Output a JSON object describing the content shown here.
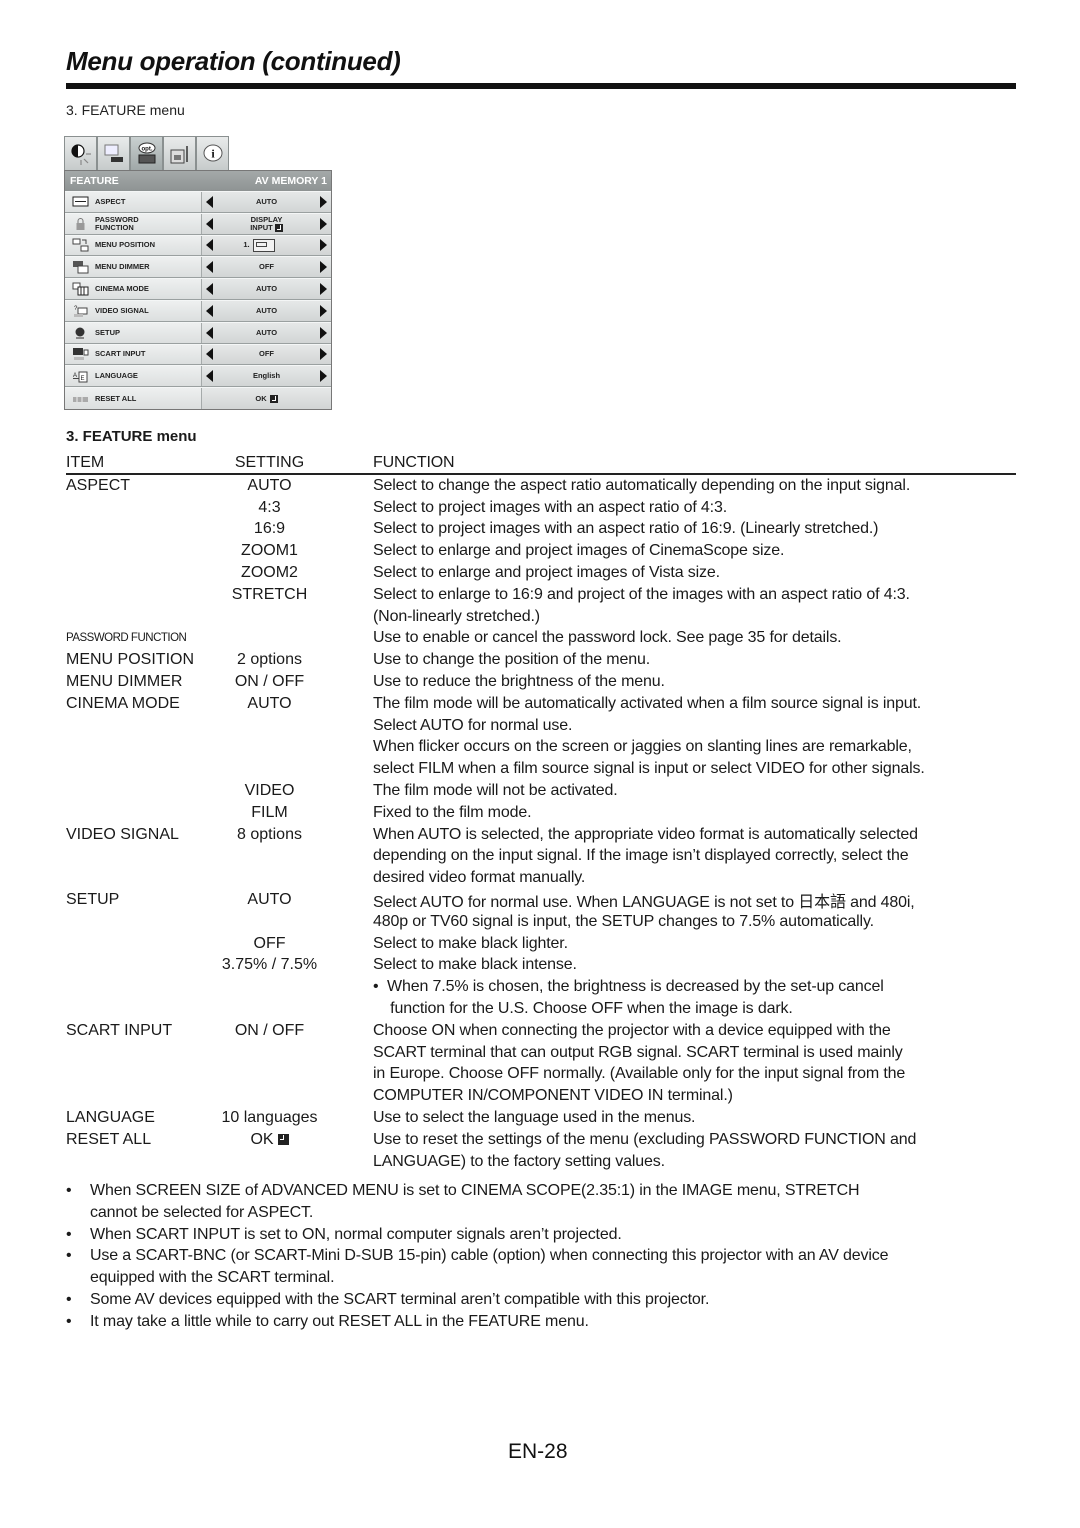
{
  "page": {
    "title": "Menu operation (continued)",
    "caption": "3. FEATURE menu",
    "section_heading": "3. FEATURE menu",
    "page_number": "EN-28"
  },
  "osd": {
    "tabs": [
      {
        "name": "image",
        "icon": "brightness-contrast-icon",
        "active": false
      },
      {
        "name": "installation",
        "icon": "projector-picture-icon",
        "active": false
      },
      {
        "name": "feature",
        "icon": "opt-projector-icon",
        "label": "opt.",
        "active": true
      },
      {
        "name": "signal",
        "icon": "signal-adjust-icon",
        "active": false
      },
      {
        "name": "information",
        "icon": "info-icon",
        "label": "i",
        "active": false
      }
    ],
    "header_left": "FEATURE",
    "header_right": "AV MEMORY 1",
    "rows": [
      {
        "icon": "aspect-icon",
        "label": "ASPECT",
        "value": "AUTO",
        "arrows": true
      },
      {
        "icon": "lock-icon",
        "label_line1": "PASSWORD",
        "label_line2": "FUNCTION",
        "value_line1": "DISPLAY",
        "value_line2": "INPUT",
        "value_enter": true,
        "arrows": true
      },
      {
        "icon": "menu-position-icon",
        "label": "MENU POSITION",
        "value": "1.",
        "value_position_box": true,
        "arrows": true
      },
      {
        "icon": "menu-dimmer-icon",
        "label": "MENU DIMMER",
        "value": "OFF",
        "arrows": true
      },
      {
        "icon": "cinema-mode-icon",
        "label": "CINEMA MODE",
        "value": "AUTO",
        "arrows": true
      },
      {
        "icon": "video-signal-icon",
        "label": "VIDEO SIGNAL",
        "value": "AUTO",
        "arrows": true
      },
      {
        "icon": "setup-icon",
        "label": "SETUP",
        "value": "AUTO",
        "arrows": true
      },
      {
        "icon": "scart-input-icon",
        "label": "SCART INPUT",
        "value": "OFF",
        "arrows": true
      },
      {
        "icon": "language-icon",
        "label": "LANGUAGE",
        "value": "English",
        "arrows": true
      },
      {
        "icon": "reset-icon",
        "label": "RESET ALL",
        "value": "OK",
        "value_enter": true,
        "arrows": false
      }
    ]
  },
  "table": {
    "headers": {
      "item": "ITEM",
      "setting": "SETTING",
      "function": "FUNCTION"
    },
    "lines": [
      {
        "item": "ASPECT",
        "setting": "AUTO",
        "function": "Select to change the aspect ratio automatically depending on the input signal."
      },
      {
        "item": "",
        "setting": "4:3",
        "function": "Select to project images with an aspect ratio of 4:3."
      },
      {
        "item": "",
        "setting": "16:9",
        "function": "Select to project images with an aspect ratio of 16:9. (Linearly stretched.)"
      },
      {
        "item": "",
        "setting": "ZOOM1",
        "function": "Select to enlarge and project images of CinemaScope size."
      },
      {
        "item": "",
        "setting": "ZOOM2",
        "function": "Select to enlarge and project images of Vista size."
      },
      {
        "item": "",
        "setting": "STRETCH",
        "function": "Select to enlarge to 16:9 and project of the images with an aspect ratio of 4:3."
      },
      {
        "item": "",
        "setting": "",
        "function": "(Non-linearly stretched.)"
      },
      {
        "item": "PASSWORD FUNCTION",
        "item_small": true,
        "setting": "",
        "function": "Use to enable or cancel the password lock. See page 35 for details."
      },
      {
        "item": "MENU POSITION",
        "setting": "2 options",
        "function": "Use to change the position of the menu."
      },
      {
        "item": "MENU DIMMER",
        "setting": "ON / OFF",
        "function": "Use to reduce the brightness of the menu."
      },
      {
        "item": "CINEMA MODE",
        "setting": "AUTO",
        "function": "The film mode will be automatically activated when a film source signal is input."
      },
      {
        "item": "",
        "setting": "",
        "function": "Select AUTO for normal use."
      },
      {
        "item": "",
        "setting": "",
        "function": "When flicker occurs on the screen or jaggies on slanting lines are remarkable,"
      },
      {
        "item": "",
        "setting": "",
        "function": "select FILM when a film source signal is input or select VIDEO for other signals."
      },
      {
        "item": "",
        "setting": "VIDEO",
        "function": "The film mode will not be activated."
      },
      {
        "item": "",
        "setting": "FILM",
        "function": "Fixed to the film mode."
      },
      {
        "item": "VIDEO SIGNAL",
        "setting": "8 options",
        "function": "When AUTO is selected, the appropriate video format is automatically selected"
      },
      {
        "item": "",
        "setting": "",
        "function": "depending on the input signal. If the image isn’t displayed correctly, select the"
      },
      {
        "item": "",
        "setting": "",
        "function": "desired video format manually."
      },
      {
        "item": "SETUP",
        "setting": "AUTO",
        "function": "Select AUTO for normal use. When LANGUAGE is not set to 日本語 and 480i,"
      },
      {
        "item": "",
        "setting": "",
        "function": "480p or TV60 signal is input, the SETUP changes to 7.5% automatically."
      },
      {
        "item": "",
        "setting": "OFF",
        "function": "Select to make black lighter."
      },
      {
        "item": "",
        "setting": "3.75% / 7.5%",
        "function": "Select to make black intense."
      },
      {
        "item": "",
        "setting": "",
        "function": "•  When 7.5% is chosen, the brightness is decreased by the set-up cancel"
      },
      {
        "item": "",
        "setting": "",
        "function": "    function for the U.S. Choose OFF when the image is dark."
      },
      {
        "item": "SCART INPUT",
        "setting": "ON / OFF",
        "function": "Choose ON when connecting the projector with a device equipped with the"
      },
      {
        "item": "",
        "setting": "",
        "function": "SCART terminal that can output RGB signal. SCART terminal is used mainly"
      },
      {
        "item": "",
        "setting": "",
        "function": "in Europe. Choose OFF normally. (Available only for the input signal from the"
      },
      {
        "item": "",
        "setting": "",
        "function": "COMPUTER IN/COMPONENT VIDEO IN terminal.)"
      },
      {
        "item": "LANGUAGE",
        "setting": "10 languages",
        "function": "Use to select the language used in the menus."
      },
      {
        "item": "RESET ALL",
        "setting": "OK",
        "setting_enter": true,
        "function": "Use to reset the settings of the menu (excluding PASSWORD FUNCTION and"
      },
      {
        "item": "",
        "setting": "",
        "function": "LANGUAGE) to the factory setting values."
      }
    ]
  },
  "notes": [
    {
      "bullet": "•",
      "lines": [
        "When SCREEN SIZE of ADVANCED MENU is set to CINEMA SCOPE(2.35:1) in the IMAGE menu, STRETCH",
        "cannot be selected for ASPECT."
      ]
    },
    {
      "bullet": "•",
      "lines": [
        "When SCART INPUT is set to ON, normal computer signals aren’t projected."
      ]
    },
    {
      "bullet": "•",
      "lines": [
        "Use a SCART-BNC (or SCART-Mini D-SUB 15-pin) cable (option) when connecting this projector with an AV device",
        "equipped with the SCART terminal."
      ]
    },
    {
      "bullet": "•",
      "lines": [
        "Some AV devices equipped with the SCART terminal aren’t compatible with this projector."
      ]
    },
    {
      "bullet": "•",
      "lines": [
        "It may take a little while to carry out RESET ALL in the FEATURE menu."
      ]
    }
  ]
}
